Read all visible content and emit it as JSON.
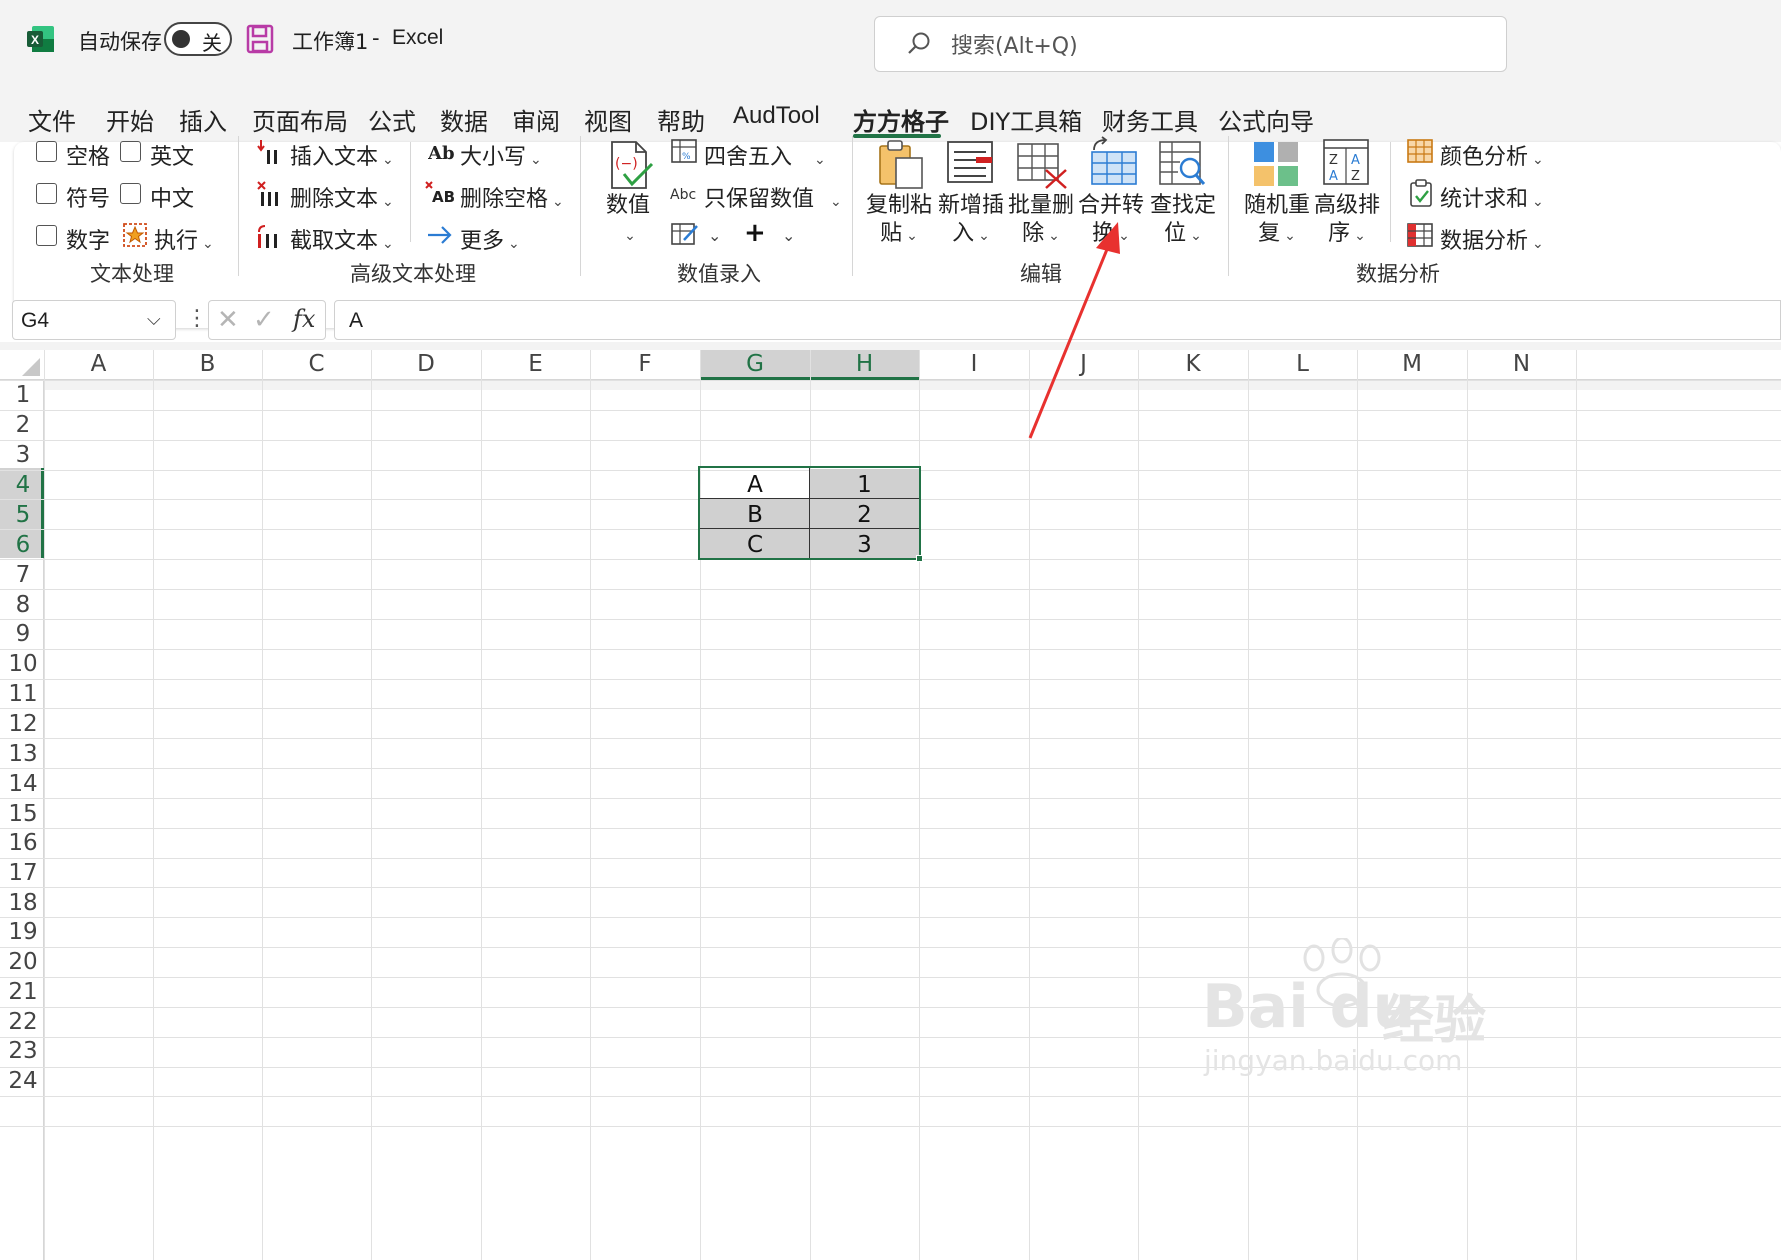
{
  "titlebar": {
    "autosave_label": "自动保存",
    "toggle_state": "关",
    "doc_title": "工作簿1",
    "separator": "-",
    "app_name": "Excel",
    "search_placeholder": "搜索(Alt+Q)"
  },
  "menu": [
    "文件",
    "开始",
    "插入",
    "页面布局",
    "公式",
    "数据",
    "审阅",
    "视图",
    "帮助",
    "AudTool",
    "方方格子",
    "DIY工具箱",
    "财务工具",
    "公式向导"
  ],
  "active_menu": "方方格子",
  "ribbon": {
    "text_processing": {
      "checkboxes": [
        "空格",
        "英文",
        "符号",
        "中文",
        "数字"
      ],
      "execute": "执行",
      "group": "文本处理"
    },
    "adv_text": {
      "insert": "插入文本",
      "delete": "删除文本",
      "extract": "截取文本",
      "case": "大小写",
      "del_space": "删除空格",
      "more": "更多",
      "group": "高级文本处理"
    },
    "numeric": {
      "value": "数值",
      "round": "四舍五入",
      "keep_numeric": "只保留数值",
      "group": "数值录入"
    },
    "edit": {
      "paste_1": "复制粘",
      "paste_2": "贴",
      "insert_1": "新增插",
      "insert_2": "入",
      "delete_1": "批量删",
      "delete_2": "除",
      "merge_1": "合并转",
      "merge_2": "换",
      "find_1": "查找定",
      "find_2": "位",
      "group": "编辑"
    },
    "analysis": {
      "random_1": "随机重",
      "random_2": "复",
      "sort_1": "高级排",
      "sort_2": "序",
      "color": "颜色分析",
      "stat": "统计求和",
      "data": "数据分析",
      "group": "数据分析"
    }
  },
  "formula_bar": {
    "name_box": "G4",
    "fx": "fx",
    "value": "A"
  },
  "columns": [
    "A",
    "B",
    "C",
    "D",
    "E",
    "F",
    "G",
    "H",
    "I",
    "J",
    "K",
    "L",
    "M",
    "N"
  ],
  "rows": [
    "1",
    "2",
    "3",
    "4",
    "5",
    "6",
    "7",
    "8",
    "9",
    "10",
    "11",
    "12",
    "13",
    "14",
    "15",
    "16",
    "17",
    "18",
    "19",
    "20",
    "21",
    "22",
    "23",
    "24"
  ],
  "cells": {
    "G4": "A",
    "H4": "1",
    "G5": "B",
    "H5": "2",
    "G6": "C",
    "H6": "3"
  },
  "colors": {
    "excel_green": "#217346",
    "selection_fill": "#d0d0d0",
    "arrow_red": "#e8312f",
    "save_purple": "#b83ba6"
  },
  "watermark": {
    "brand": "Bai du",
    "cn": "经验",
    "url": "jingyan.baidu.com"
  }
}
